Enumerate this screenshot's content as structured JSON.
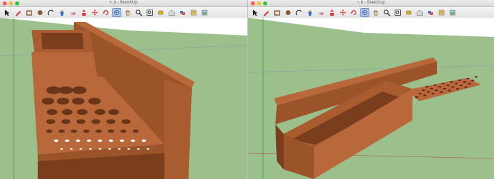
{
  "windows": {
    "left": {
      "title": "•, b - SketchUp"
    },
    "right": {
      "title": "•, b - SketchUp"
    }
  },
  "colors": {
    "sky": "#ffffff",
    "ground": "#9cc08c",
    "wood_light": "#b8683a",
    "wood_mid": "#9b5329",
    "wood_dark": "#7a3e1c",
    "close": "#fd5f57",
    "minimize": "#febc2e",
    "zoom": "#28c840",
    "selected_tool": "#a9c4e8"
  },
  "toolbar_tools": [
    {
      "name": "select-icon",
      "glyph": "select",
      "active": false
    },
    {
      "name": "pencil-icon",
      "glyph": "pencil",
      "active": false
    },
    {
      "name": "rectangle-icon",
      "glyph": "rect",
      "active": false
    },
    {
      "name": "circle-icon",
      "glyph": "circle",
      "active": false
    },
    {
      "name": "arc-icon",
      "glyph": "arc",
      "active": false
    },
    {
      "name": "paint-bucket-icon",
      "glyph": "bucket",
      "active": false
    },
    {
      "name": "eraser-icon",
      "glyph": "eraser",
      "active": false
    },
    {
      "name": "push-pull-icon",
      "glyph": "pushpull",
      "active": false
    },
    {
      "name": "move-icon",
      "glyph": "move",
      "active": false
    },
    {
      "name": "rotate-icon",
      "glyph": "rotate",
      "active": false
    },
    {
      "name": "orbit-icon",
      "glyph": "orbit",
      "active": true
    },
    {
      "name": "pan-icon",
      "glyph": "pan",
      "active": false
    },
    {
      "name": "zoom-icon",
      "glyph": "zoom",
      "active": false
    },
    {
      "name": "zoom-extents-icon",
      "glyph": "extents",
      "active": false
    },
    {
      "name": "tape-measure-icon",
      "glyph": "tape",
      "active": false
    },
    {
      "name": "warehouse-icon",
      "glyph": "warehouse",
      "active": false
    },
    {
      "name": "components-icon",
      "glyph": "components",
      "active": false
    },
    {
      "name": "extension-icon",
      "glyph": "extension",
      "active": false
    },
    {
      "name": "styles-icon",
      "glyph": "styles",
      "active": false
    }
  ]
}
